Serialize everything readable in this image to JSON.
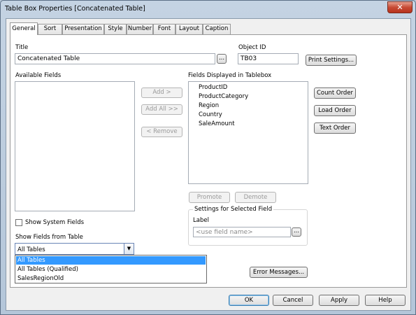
{
  "window": {
    "title": "Table Box Properties [Concatenated Table]",
    "close_glyph": "✕"
  },
  "tabs": [
    {
      "label": "General"
    },
    {
      "label": "Sort"
    },
    {
      "label": "Presentation"
    },
    {
      "label": "Style"
    },
    {
      "label": "Number"
    },
    {
      "label": "Font"
    },
    {
      "label": "Layout"
    },
    {
      "label": "Caption"
    }
  ],
  "active_tab": "General",
  "general": {
    "title_label": "Title",
    "title_value": "Concatenated Table",
    "browse_label": "...",
    "object_id_label": "Object ID",
    "object_id_value": "TB03",
    "print_settings_label": "Print Settings...",
    "available_fields_label": "Available Fields",
    "add_label": "Add >",
    "add_all_label": "Add All >>",
    "remove_label": "< Remove",
    "displayed_fields_label": "Fields Displayed in Tablebox",
    "displayed_fields": [
      "ProductID",
      "ProductCategory",
      "Region",
      "Country",
      "SaleAmount"
    ],
    "count_order_label": "Count Order",
    "load_order_label": "Load Order",
    "text_order_label": "Text Order",
    "promote_label": "Promote",
    "demote_label": "Demote",
    "settings_group_label": "Settings for Selected Field",
    "label_label": "Label",
    "label_placeholder": "<use field name>",
    "show_system_fields_label": "Show System Fields",
    "show_system_fields_checked": false,
    "show_fields_from_label": "Show Fields from Table",
    "show_fields_from_value": "All Tables",
    "dropdown_options": [
      "All Tables",
      "All Tables (Qualified)",
      "SalesRegionOld"
    ],
    "dropdown_selected_index": 0,
    "error_messages_label": "Error Messages..."
  },
  "footer": {
    "ok_label": "OK",
    "cancel_label": "Cancel",
    "apply_label": "Apply",
    "help_label": "Help"
  },
  "colors": {
    "selection": "#3399ff",
    "window_frame": "#b9c9da"
  }
}
